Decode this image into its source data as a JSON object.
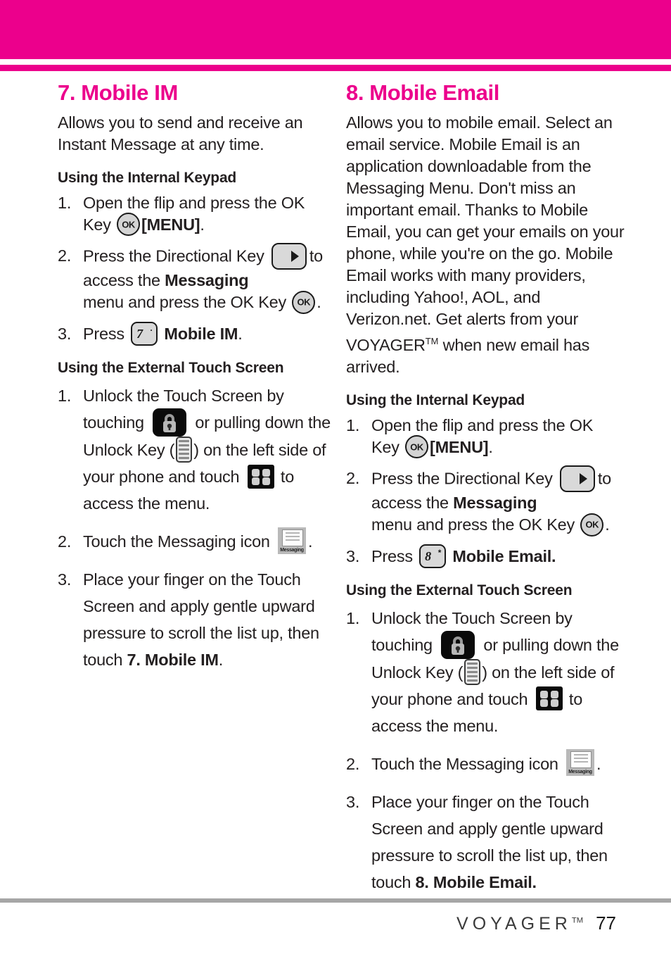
{
  "theme": {
    "accent": "#ec008c",
    "text": "#231f20",
    "rule": "#a6a6a6"
  },
  "left_column": {
    "title": "7. Mobile IM",
    "intro": "Allows you to send and receive an Instant Message at any time.",
    "internal_heading": "Using the Internal Keypad",
    "internal_steps": {
      "s1": {
        "num": "1.",
        "a": "Open the flip and press the OK Key",
        "b": "[MENU]",
        "c": "."
      },
      "s2": {
        "num": "2.",
        "a": "Press the Directional Key",
        "b": "to access the",
        "c": "Messaging",
        "d": "menu and press the OK Key",
        "e": "."
      },
      "s3": {
        "num": "3.",
        "a": "Press",
        "b": "Mobile IM",
        "c": "."
      }
    },
    "external_heading": "Using the External Touch Screen",
    "external_steps": {
      "s1": {
        "num": "1.",
        "a": "Unlock the Touch Screen by touching",
        "b": "or pulling down the Unlock Key (",
        "c": ") on the left side of your phone and touch",
        "d": "to access the menu."
      },
      "s2": {
        "num": "2.",
        "a": "Touch the Messaging icon",
        "b": "."
      },
      "s3": {
        "num": "3.",
        "a": "Place your finger on the Touch Screen and apply gentle upward pressure to scroll the list up, then touch",
        "b": "7. Mobile IM",
        "c": "."
      }
    }
  },
  "right_column": {
    "title": "8. Mobile Email",
    "intro_part1": "Allows you to mobile email. Select an email service. Mobile Email is an application downloadable from the Messaging Menu. Don't miss an important email. Thanks to Mobile Email, you can get your emails on your phone, while you're on the go. Mobile Email works with many providers, including Yahoo!, AOL, and Verizon.net. Get alerts from your VOYAGER",
    "intro_tm": "TM",
    "intro_part2": " when new email has arrived.",
    "internal_heading": "Using the Internal Keypad",
    "internal_steps": {
      "s1": {
        "num": "1.",
        "a": "Open the flip and press the OK Key",
        "b": "[MENU]",
        "c": "."
      },
      "s2": {
        "num": "2.",
        "a": "Press the Directional Key",
        "b": "to access the",
        "c": "Messaging",
        "d": "menu and press the OK Key",
        "e": "."
      },
      "s3": {
        "num": "3.",
        "a": "Press",
        "b": "Mobile Email."
      }
    },
    "external_heading": "Using the External Touch Screen",
    "external_steps": {
      "s1": {
        "num": "1.",
        "a": "Unlock the Touch Screen by touching",
        "b": "or pulling down the Unlock Key (",
        "c": ") on the left side of your phone and touch",
        "d": "to access the menu."
      },
      "s2": {
        "num": "2.",
        "a": "Touch the Messaging icon",
        "b": "."
      },
      "s3": {
        "num": "3.",
        "a": "Place your finger on the Touch Screen and apply gentle upward pressure to scroll the list up, then touch",
        "b": "8. Mobile Email."
      }
    }
  },
  "icons": {
    "ok_key_label": "OK",
    "key_seven_digit": "7",
    "key_seven_sup": "·",
    "key_eight_digit": "8",
    "key_eight_sup": "*",
    "messaging_tile_label": "Messaging"
  },
  "footer": {
    "brand": "VOYAGER",
    "brand_tm": "TM",
    "page_number": "77"
  }
}
